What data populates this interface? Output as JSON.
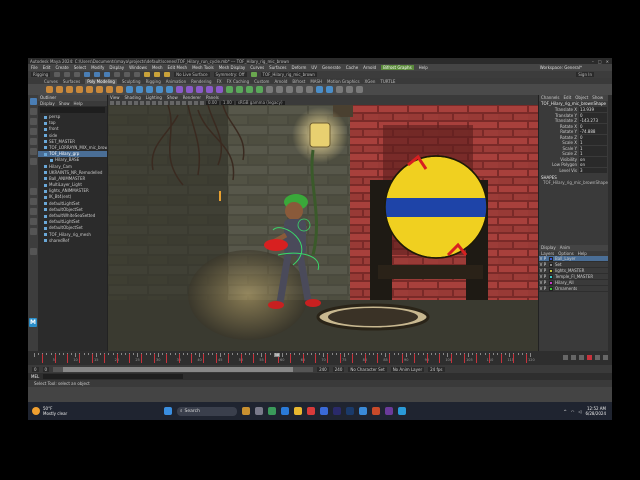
{
  "window": {
    "title": "Autodesk Maya 2024: C:\\Users\\Documents\\maya\\projects\\default\\scenes\\TOF_Hilary_run_cycle.mb*  ---  TOF_Hilary_rig_mic_brown"
  },
  "menubar": {
    "items": [
      "File",
      "Edit",
      "Create",
      "Select",
      "Modify",
      "Display",
      "Windows",
      "Mesh",
      "Edit Mesh",
      "Mesh Tools",
      "Mesh Display",
      "Curves",
      "Surfaces",
      "Deform",
      "UV",
      "Generate",
      "Cache",
      "Arnold",
      "Bifrost Graphs",
      "Help"
    ],
    "highlight_index": 18,
    "workspace_label": "Workspace: General*"
  },
  "statusline": {
    "mode": "Rigging",
    "live_surface": "No Live Surface",
    "symmetry": "Symmetry: Off",
    "name_field": "TOF_Hilary_rig_mic_brown",
    "sign_in": "Sign In"
  },
  "shelf": {
    "tabs": [
      "Curves",
      "Surfaces",
      "Poly Modeling",
      "Sculpting",
      "Rigging",
      "Animation",
      "Rendering",
      "FX",
      "FX Caching",
      "Custom",
      "Arnold",
      "Bifrost",
      "MASH",
      "Motion Graphics",
      "XGen",
      "TURTLE"
    ],
    "active_index": 2
  },
  "outliner": {
    "title": "Outliner",
    "menu": [
      "Display",
      "Show",
      "Help"
    ],
    "items": [
      {
        "label": "persp",
        "sel": false,
        "indent": false
      },
      {
        "label": "top",
        "sel": false,
        "indent": false
      },
      {
        "label": "front",
        "sel": false,
        "indent": false
      },
      {
        "label": "side",
        "sel": false,
        "indent": false
      },
      {
        "label": "SET_MASTER",
        "sel": false,
        "indent": false
      },
      {
        "label": "TOF_LORRAYN_MIX_mic_brown",
        "sel": false,
        "indent": false
      },
      {
        "label": "TOF_Hilary_grp",
        "sel": true,
        "indent": false
      },
      {
        "label": "Hilary_BASE",
        "sel": false,
        "indent": true
      },
      {
        "label": "Hilary_Cam",
        "sel": false,
        "indent": false
      },
      {
        "label": "UKRAINTS_NR_Remodelled",
        "sel": false,
        "indent": false
      },
      {
        "label": "Ball_ANIMMASTER",
        "sel": false,
        "indent": false
      },
      {
        "label": "MultiLayer_Light",
        "sel": false,
        "indent": false
      },
      {
        "label": "lights_ANIMMASTER",
        "sel": false,
        "indent": false
      },
      {
        "label": "IK_Bt4(ent)",
        "sel": false,
        "indent": false
      },
      {
        "label": "defaultLightSet",
        "sel": false,
        "indent": false
      },
      {
        "label": "defaultObjectSet",
        "sel": false,
        "indent": false
      },
      {
        "label": "defaultWhiteSeaSetted",
        "sel": false,
        "indent": false
      },
      {
        "label": "defaultLightSet",
        "sel": false,
        "indent": false
      },
      {
        "label": "defaultObjectSet",
        "sel": false,
        "indent": false
      },
      {
        "label": "TOF_Hilary_rig_mesh",
        "sel": false,
        "indent": false
      },
      {
        "label": "sharedRef",
        "sel": false,
        "indent": false
      }
    ]
  },
  "viewport": {
    "menu": [
      "View",
      "Shading",
      "Lighting",
      "Show",
      "Renderer",
      "Panels"
    ],
    "near": "0.00",
    "far": "1.00",
    "colorspace": "sRGB gamma (legacy)"
  },
  "channelbox": {
    "menu": [
      "Channels",
      "Edit",
      "Object",
      "Show"
    ],
    "object": "TOF_Hilary_rig_mic_brownShape",
    "channels": [
      {
        "label": "Translate X",
        "value": "13.939"
      },
      {
        "label": "Translate Y",
        "value": "0"
      },
      {
        "label": "Translate Z",
        "value": "-143.273"
      },
      {
        "label": "Rotate X",
        "value": "0"
      },
      {
        "label": "Rotate Y",
        "value": "-74.888"
      },
      {
        "label": "Rotate Z",
        "value": "0"
      },
      {
        "label": "Scale X",
        "value": "1"
      },
      {
        "label": "Scale Y",
        "value": "1"
      },
      {
        "label": "Scale Z",
        "value": "1"
      },
      {
        "label": "Visibility",
        "value": "on"
      },
      {
        "label": "Low Polygon",
        "value": "on"
      },
      {
        "label": "Level Vis",
        "value": "3"
      }
    ],
    "shapes_label": "SHAPES",
    "shape_item": "TOF_Hilary_rig_mic_brownShape"
  },
  "layers": {
    "tabs": [
      "Display",
      "Anim"
    ],
    "menu": [
      "Layers",
      "Options",
      "Help"
    ],
    "rows": [
      {
        "name": "Ball_Layer",
        "color": "#3a5ad8",
        "sel": true
      },
      {
        "name": "Set",
        "color": "#888888",
        "sel": false
      },
      {
        "name": "lights_MASTER",
        "color": "#c8c83a",
        "sel": false
      },
      {
        "name": "Temple_FI_MASTER",
        "color": "#3ac8c8",
        "sel": false
      },
      {
        "name": "Hilary_All",
        "color": "#c83ac8",
        "sel": false
      },
      {
        "name": "Ornaments",
        "color": "#3ac83a",
        "sel": false
      }
    ]
  },
  "timeline": {
    "tick_labels": [
      "5",
      "10",
      "15",
      "20",
      "25",
      "30",
      "35",
      "40",
      "45",
      "50",
      "55",
      "60",
      "65",
      "70",
      "75",
      "80",
      "85",
      "90",
      "95",
      "100",
      "105",
      "110",
      "115",
      "120"
    ],
    "current_frame": "58"
  },
  "range": {
    "start": "0",
    "range_start": "0",
    "range_end": "240",
    "end": "240",
    "char_set": "No Character Set",
    "anim_layer": "No Anim Layer",
    "fps": "24 fps"
  },
  "cmdline": {
    "lang": "MEL"
  },
  "helpline": {
    "text": "Select Tool: select an object"
  },
  "taskbar": {
    "temp": "50°F",
    "cond": "Mostly clear",
    "search": "Search",
    "time": "12:52 AM",
    "date": "6/28/2024"
  }
}
